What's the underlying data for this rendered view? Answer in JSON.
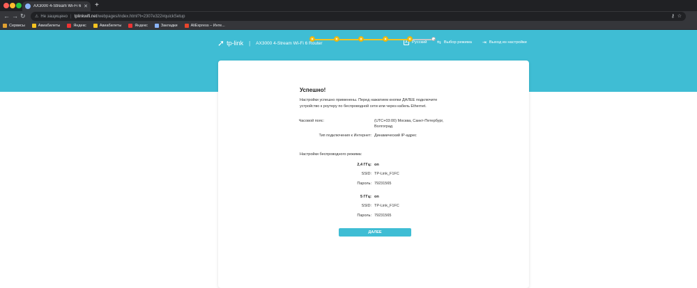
{
  "browser": {
    "tab_title": "AX3000 4-Stream Wi-Fi 6 Rou",
    "not_secure": "Не защищено",
    "url_host": "tplinkwifi.net",
    "url_path": "/webpages/index.html?t=2307e322#quickSetup",
    "bookmarks": [
      "Сервисы",
      "Авиабилеты",
      "Яндекс",
      "Авиабилеты",
      "Яндекс",
      "Закладки",
      "AliExpress – Инте..."
    ]
  },
  "header": {
    "brand": "tp-link",
    "model": "AX3000 4-Stream Wi-Fi 6 Router",
    "nav": {
      "language": "Русский",
      "mode": "Выбор режима",
      "logout": "Выход из настройки"
    }
  },
  "wizard": {
    "steps_total": 6,
    "steps_completed": 5,
    "title": "Успешно!",
    "description": "Настройки успешно применены. Перед нажатием кнопки ДАЛЕЕ подключите устройство к роутеру по беспроводной сети или через кабель Ethernet.",
    "timezone_label": "Часовой пояс:",
    "timezone_value": "(UTC+03:00) Москва, Санкт-Петербург, Волгоград",
    "conn_label": "Тип подключения к Интернет:",
    "conn_value": "Динамический IP-адрес",
    "wireless_title": "Настройки беспроводного режима:",
    "band24": {
      "label": "2,4 ГГц:",
      "state": "on",
      "ssid_label": "SSID:",
      "ssid": "TP-Link_F1FC",
      "pass_label": "Пароль:",
      "password": "79231565"
    },
    "band5": {
      "label": "5 ГГц:",
      "state": "on",
      "ssid_label": "SSID:",
      "ssid": "TP-Link_F1FC",
      "pass_label": "Пароль:",
      "password": "79231565"
    },
    "next_button": "ДАЛЕЕ"
  },
  "colors": {
    "accent": "#3fbdd4",
    "step": "#f5c320"
  }
}
